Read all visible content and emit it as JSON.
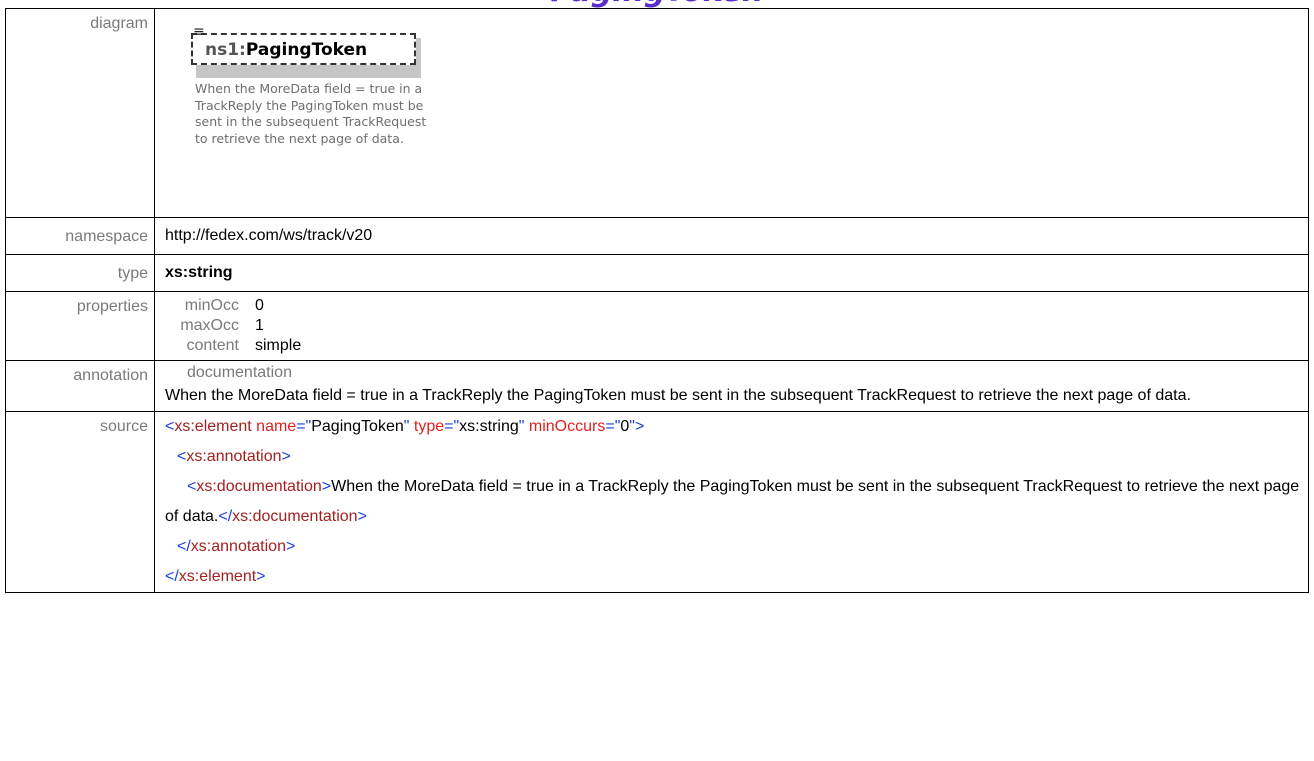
{
  "title_fragment": "PagingToken",
  "labels": {
    "diagram": "diagram",
    "namespace": "namespace",
    "type": "type",
    "properties": "properties",
    "annotation": "annotation",
    "source": "source"
  },
  "diagram": {
    "prefix": "ns1:",
    "element_name": "PagingToken",
    "doc_text": "When the MoreData field = true in a TrackReply the PagingToken must be sent in the subsequent TrackRequest to retrieve the next page of data."
  },
  "namespace_value": "http://fedex.com/ws/track/v20",
  "type_value": "xs:string",
  "properties": [
    {
      "key": "minOcc",
      "value": "0"
    },
    {
      "key": "maxOcc",
      "value": "1"
    },
    {
      "key": "content",
      "value": "simple"
    }
  ],
  "annotation": {
    "heading": "documentation",
    "text": "When the MoreData field = true in a TrackReply the PagingToken must be sent in the subsequent TrackRequest to retrieve the next page of data."
  },
  "source": {
    "open_tag": "xs:element",
    "attr_name": "name",
    "attr_name_val": "PagingToken",
    "attr_type": "type",
    "attr_type_val": "xs:string",
    "attr_min": "minOccurs",
    "attr_min_val": "0",
    "annotation_tag": "xs:annotation",
    "documentation_tag": "xs:documentation",
    "documentation_text": "When the MoreData field = true in a TrackReply the PagingToken must be sent in the subsequent TrackRequest to retrieve the next page of data."
  },
  "colors": {
    "bracket": "#1a3fd6",
    "tag": "#a51f1f",
    "attr": "#e02020",
    "label": "#7a7a7a"
  }
}
